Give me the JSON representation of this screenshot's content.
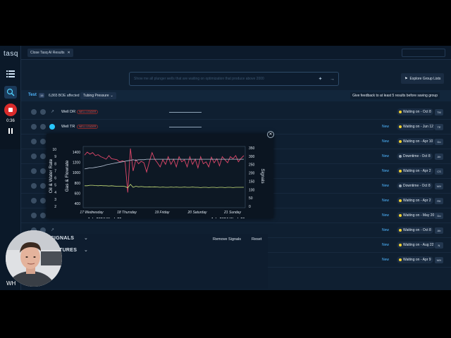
{
  "app": {
    "logo": "tasq"
  },
  "topbar": {
    "tab_label": "Close Tasq AI  Results",
    "ghost_button": ""
  },
  "recorder": {
    "time": "0:36"
  },
  "search": {
    "placeholder": "Show me all plunger wells that are waiting on optimization that produce above 2000"
  },
  "explore_button": "Explore Group Lists",
  "filter": {
    "name": "Test",
    "count": "15",
    "boe": "6,865 BOE affected",
    "chip": "Tubing Pressure",
    "feedback": "Give feedback to at least 5 results before saving group"
  },
  "rows": [
    {
      "name": "Well DR",
      "tag": "WELL LEADER",
      "new": "",
      "status": "Waiting on - Oct 8",
      "status_color": "#f2d231",
      "initials": "TM"
    },
    {
      "name": "Well TR",
      "tag": "WELL LEADER",
      "new": "New",
      "status": "Waiting on - Jun 12",
      "status_color": "#f2d231",
      "initials": "TE"
    },
    {
      "name": "",
      "tag": "",
      "new": "New",
      "status": "Waiting on - Apr 10",
      "status_color": "#f2d231",
      "initials": "Do"
    },
    {
      "name": "",
      "tag": "",
      "new": "New",
      "status": "Downtime - Oct 8",
      "status_color": "#9aa7b4",
      "initials": "Ab"
    },
    {
      "name": "",
      "tag": "",
      "new": "New",
      "status": "Waiting on - Apr 2",
      "status_color": "#f2d231",
      "initials": "CS"
    },
    {
      "name": "",
      "tag": "",
      "new": "New",
      "status": "Downtime - Oct 8",
      "status_color": "#9aa7b4",
      "initials": "WH"
    },
    {
      "name": "",
      "tag": "",
      "new": "New",
      "status": "Waiting on - Apr 2",
      "status_color": "#f2d231",
      "initials": "RK"
    },
    {
      "name": "",
      "tag": "",
      "new": "New",
      "status": "Waiting on - May 20",
      "status_color": "#f2d231",
      "initials": "Do"
    },
    {
      "name": "",
      "tag": "",
      "new": "New",
      "status": "Waiting on - Oct 8",
      "status_color": "#f2d231",
      "initials": "Ab"
    },
    {
      "name": "",
      "tag": "",
      "new": "New",
      "status": "Waiting on - Aug 22",
      "status_color": "#f2d231",
      "initials": "N"
    },
    {
      "name": "",
      "tag": "",
      "new": "New",
      "status": "Waiting on - Apr 9",
      "status_color": "#f2d231",
      "initials": "WH"
    }
  ],
  "panel": {
    "signals_label": "SIGNALS",
    "features_label": "TURES",
    "remove_signals": "Remove Signals",
    "reset": "Reset",
    "count_2": "2"
  },
  "webcam": {
    "initials": "WH"
  },
  "chart_data": {
    "type": "line",
    "left_axis_label_outer": "Oil & Water Rate",
    "left_axis_label_inner": "Gas & Flowrate",
    "right_axis_label": "Signals",
    "left_outer_ticks": [
      "10",
      "9",
      "8",
      "7",
      "6",
      "5",
      "4",
      "3",
      "2"
    ],
    "left_inner_ticks": [
      "1400",
      "1200",
      "1000",
      "800",
      "600",
      "400"
    ],
    "right_ticks": [
      "350",
      "300",
      "250",
      "200",
      "150",
      "100",
      "50",
      "0"
    ],
    "x_ticks": [
      "17 Wednesday",
      "18 Thursday",
      "19 Friday",
      "20 Saturday",
      "21 Sunday"
    ],
    "x_groups": [
      "July 2024 Week 29",
      "July 2024 Week 30"
    ],
    "ylim_inner": [
      300,
      1500
    ],
    "series": [
      {
        "color": "#e0476a",
        "values": [
          1330,
          1390,
          1350,
          1380,
          1320,
          1340,
          1300,
          1280,
          1250,
          1320,
          1260,
          1250,
          1240,
          1200,
          1220,
          1200,
          600,
          1460,
          1020,
          1240,
          1160,
          1210,
          1180,
          1000,
          1200,
          1380,
          1250,
          1180,
          1100,
          1240,
          1150,
          1300,
          1150,
          1250,
          1100,
          1300,
          1200,
          1240,
          1100,
          1300,
          1150,
          1250,
          1080,
          1300,
          1160,
          1200,
          1100,
          1290,
          1180,
          1260,
          1120,
          1300,
          1240,
          1180,
          1300,
          1260,
          1320,
          1200,
          1270,
          1320
        ]
      },
      {
        "color": "#b8c4d6",
        "values": [
          1060,
          1070,
          1080,
          1080,
          1090,
          1100,
          1110,
          1120,
          1140,
          1150,
          1160,
          1170,
          1180,
          1190,
          1200,
          1210,
          1220,
          1230,
          1240,
          1230,
          1240,
          1240,
          1240,
          1250,
          1250,
          1250,
          1250,
          1250,
          1250,
          1250,
          1250,
          1250,
          1250,
          1250,
          1250,
          1250,
          1250,
          1250,
          1250,
          1250,
          1250,
          1250,
          1250,
          1250,
          1250,
          1250,
          1250,
          1250,
          1250,
          1250,
          1250,
          1250,
          1250,
          1250,
          1250,
          1250,
          1250,
          1250,
          1250,
          1250
        ]
      },
      {
        "color": "#c9e27a",
        "values": [
          730,
          730,
          740,
          740,
          735,
          730,
          735,
          730,
          730,
          725,
          730,
          725,
          720,
          720,
          720,
          715,
          690,
          760,
          700,
          720,
          710,
          715,
          710,
          705,
          710,
          705,
          710,
          705,
          700,
          705,
          700,
          700,
          705,
          700,
          705,
          700,
          700,
          705,
          700,
          700,
          705,
          700,
          700,
          695,
          700,
          700,
          695,
          700,
          700,
          695,
          700,
          700,
          695,
          700,
          700,
          695,
          700,
          700,
          700,
          700
        ]
      }
    ]
  }
}
